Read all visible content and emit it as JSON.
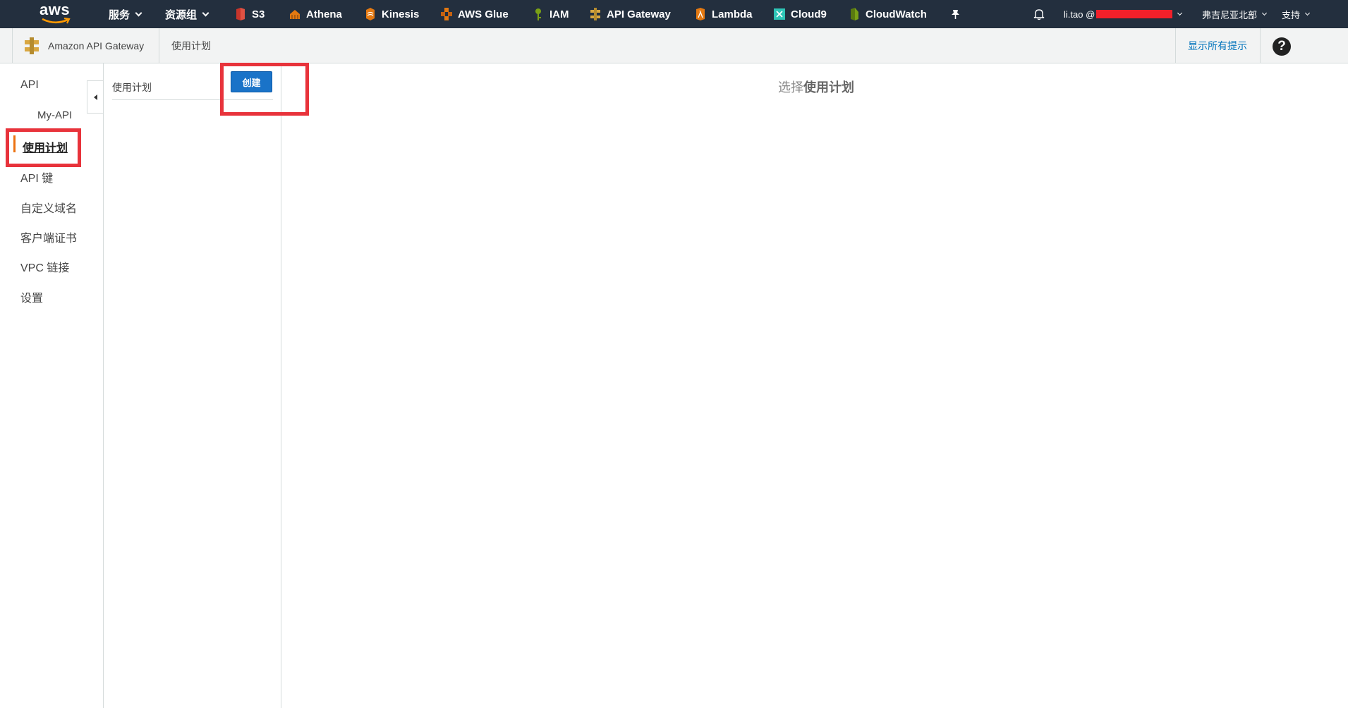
{
  "topnav": {
    "logo": "aws",
    "services": "服务",
    "resource_groups": "资源组",
    "shortcuts": [
      {
        "label": "S3",
        "icon": "s3-icon",
        "color": "#e05243"
      },
      {
        "label": "Athena",
        "icon": "athena-icon",
        "color": "#e47911"
      },
      {
        "label": "Kinesis",
        "icon": "kinesis-icon",
        "color": "#e47911"
      },
      {
        "label": "AWS Glue",
        "icon": "glue-icon",
        "color": "#e47911"
      },
      {
        "label": "IAM",
        "icon": "iam-icon",
        "color": "#7aa116"
      },
      {
        "label": "API Gateway",
        "icon": "api-gateway-icon",
        "color": "#d9a741"
      },
      {
        "label": "Lambda",
        "icon": "lambda-icon",
        "color": "#e47911"
      },
      {
        "label": "Cloud9",
        "icon": "cloud9-icon",
        "color": "#2ec4b6"
      },
      {
        "label": "CloudWatch",
        "icon": "cloudwatch-icon",
        "color": "#7aa116"
      }
    ],
    "user": "li.tao @",
    "region": "弗吉尼亚北部",
    "support": "支持"
  },
  "subheader": {
    "service_name": "Amazon API Gateway",
    "breadcrumb": "使用计划",
    "hints": "显示所有提示",
    "help": "?"
  },
  "leftnav": {
    "api": "API",
    "my_api": "My-API",
    "usage_plans": "使用计划",
    "api_keys": "API 键",
    "custom_domains": "自定义域名",
    "client_certs": "客户端证书",
    "vpc_links": "VPC 链接",
    "settings": "设置"
  },
  "panel": {
    "title": "使用计划",
    "create": "创建"
  },
  "main": {
    "prefix": "选择",
    "bold": "使用计划"
  }
}
